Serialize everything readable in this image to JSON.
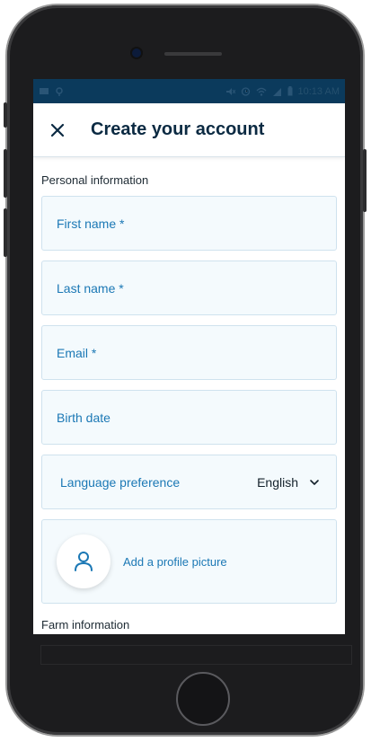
{
  "status_bar": {
    "left_icons": [
      "message-icon",
      "location-icon"
    ],
    "right_icons": [
      "mute-icon",
      "alarm-icon",
      "wifi-icon",
      "signal-icon",
      "battery-icon"
    ],
    "time": "10:13 AM"
  },
  "app_bar": {
    "title": "Create your account",
    "close_icon": "close-icon"
  },
  "personal_section": {
    "label": "Personal information",
    "fields": {
      "first_name": "First name *",
      "last_name": "Last name *",
      "email": "Email *",
      "birth_date": "Birth date"
    },
    "language": {
      "label": "Language preference",
      "value": "English",
      "icon": "chevron-down-icon"
    },
    "profile_picture": {
      "label": "Add a profile picture",
      "icon": "person-icon"
    }
  },
  "next_section": {
    "label": "Farm information"
  },
  "colors": {
    "status_bar": "#0b3a5c",
    "accent": "#1b78b5",
    "field_bg": "#f4fafd",
    "field_border": "#cfe2ee",
    "title": "#0b2a42"
  }
}
